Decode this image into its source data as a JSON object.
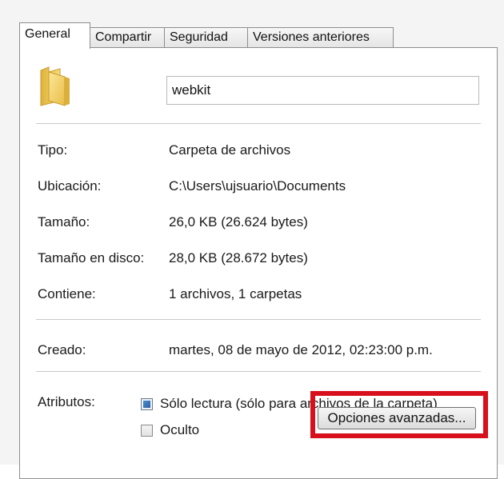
{
  "tabs": [
    {
      "label": "General",
      "active": true
    },
    {
      "label": "Compartir",
      "active": false
    },
    {
      "label": "Seguridad",
      "active": false
    },
    {
      "label": "Versiones anteriores",
      "active": false
    }
  ],
  "folder": {
    "icon": "folder-icon",
    "name": "webkit"
  },
  "properties": {
    "tipo": {
      "label": "Tipo:",
      "value": "Carpeta de archivos"
    },
    "ubicacion": {
      "label": "Ubicación:",
      "value": "C:\\Users\\ujsuario\\Documents"
    },
    "tamano": {
      "label": "Tamaño:",
      "value": "26,0 KB (26.624 bytes)"
    },
    "tamano_disco": {
      "label": "Tamaño en disco:",
      "value": "28,0 KB (28.672 bytes)"
    },
    "contiene": {
      "label": "Contiene:",
      "value": "1 archivos, 1 carpetas"
    },
    "creado": {
      "label": "Creado:",
      "value": "martes, 08 de mayo de 2012, 02:23:00 p.m."
    }
  },
  "attributes": {
    "label": "Atributos:",
    "read_only": {
      "label": "Sólo lectura (sólo para archivos de la carpeta)",
      "state": "indeterminate"
    },
    "hidden": {
      "label": "Oculto",
      "state": "unchecked"
    },
    "advanced_button": "Opciones avanzadas..."
  },
  "colors": {
    "highlight": "#d7101c",
    "folder": "#f2cf5b"
  }
}
